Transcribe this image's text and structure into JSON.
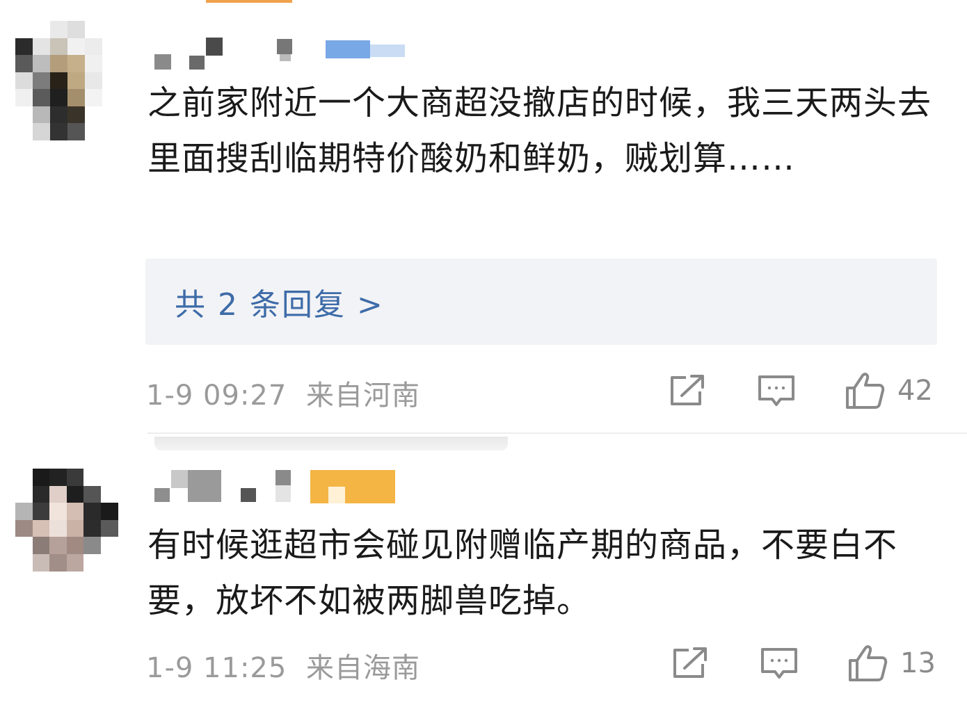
{
  "comments": [
    {
      "text": "之前家附近一个大商超没撤店的时候，我三天两头去里面搜刮临期特价酸奶和鲜奶，贼划算……",
      "reply_link": "共 2 条回复 >",
      "timestamp": "1-9 09:27",
      "location": "来自河南",
      "likes": "42",
      "icons": {
        "share": "share-icon",
        "comment": "comment-icon",
        "like": "thumbs-up-icon"
      }
    },
    {
      "text": "有时候逛超市会碰见附赠临产期的商品，不要白不要，放坏不如被两脚兽吃掉。",
      "timestamp": "1-9 11:25",
      "location": "来自海南",
      "likes": "13",
      "icons": {
        "share": "share-icon",
        "comment": "comment-icon",
        "like": "thumbs-up-icon"
      }
    }
  ],
  "colors": {
    "reply_link": "#3d6ba8",
    "meta_text": "#9a9a9a",
    "reply_box_bg": "#f2f3f6",
    "top_accent": "#f0a24c"
  }
}
